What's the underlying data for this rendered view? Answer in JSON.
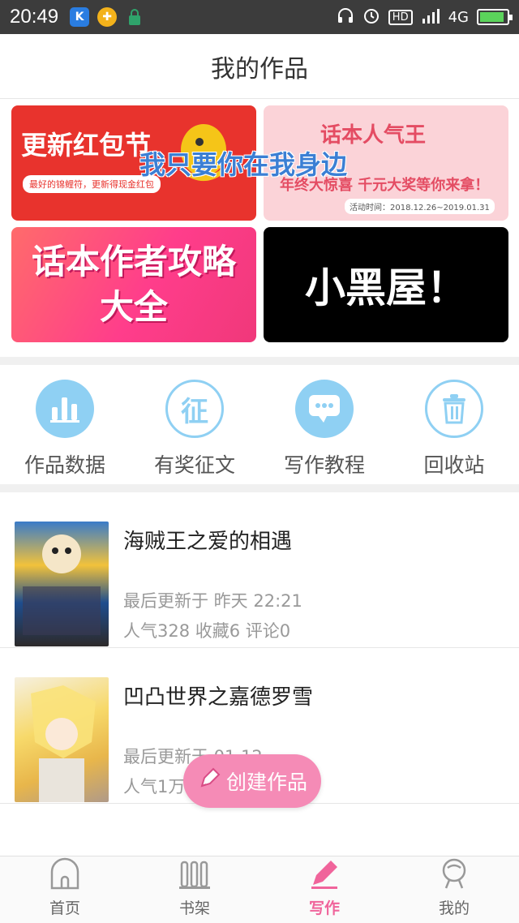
{
  "status_bar": {
    "time": "20:49",
    "network": "4G",
    "hd": "HD",
    "left_icons": [
      "k-app-icon",
      "game-icon",
      "lock-icon"
    ],
    "right_icons": [
      "headphones-icon",
      "alarm-icon",
      "hd-icon",
      "signal-icon",
      "battery-icon"
    ],
    "battery_level": 0.9
  },
  "header": {
    "title": "我的作品"
  },
  "banners": [
    {
      "text": "更新红包节",
      "sub": "最好的锦鲤符，更新得现金红包"
    },
    {
      "text": "话本人气王",
      "sub": "年终大惊喜 千元大奖等你来拿！",
      "date": "活动时间：2018.12.26~2019.01.31"
    },
    {
      "text": "话本作者攻略大全"
    },
    {
      "text": "小黑屋！"
    }
  ],
  "overlay": {
    "text": "我只要你在我身边"
  },
  "tools": [
    {
      "label": "作品数据",
      "icon": "bar-chart-icon"
    },
    {
      "label": "有奖征文",
      "icon": "zheng-icon",
      "glyph": "征"
    },
    {
      "label": "写作教程",
      "icon": "chat-bubble-icon"
    },
    {
      "label": "回收站",
      "icon": "trash-icon"
    }
  ],
  "works": [
    {
      "title": "海贼王之爱的相遇",
      "updated": "最后更新于 昨天 22:21",
      "stats": "人气328  收藏6  评论0"
    },
    {
      "title": "凹凸世界之嘉德罗雪",
      "updated": "最后更新于 01.12",
      "stats": "人气1万"
    }
  ],
  "create_button": {
    "label": "创建作品"
  },
  "tabbar": {
    "items": [
      {
        "label": "首页",
        "icon": "home-icon"
      },
      {
        "label": "书架",
        "icon": "bookshelf-icon"
      },
      {
        "label": "写作",
        "icon": "pen-icon",
        "active": true
      },
      {
        "label": "我的",
        "icon": "profile-icon"
      }
    ]
  },
  "colors": {
    "accent": "#f0649b",
    "tool_blue": "#8fd0f3",
    "status_bg": "#3c3c3c"
  }
}
